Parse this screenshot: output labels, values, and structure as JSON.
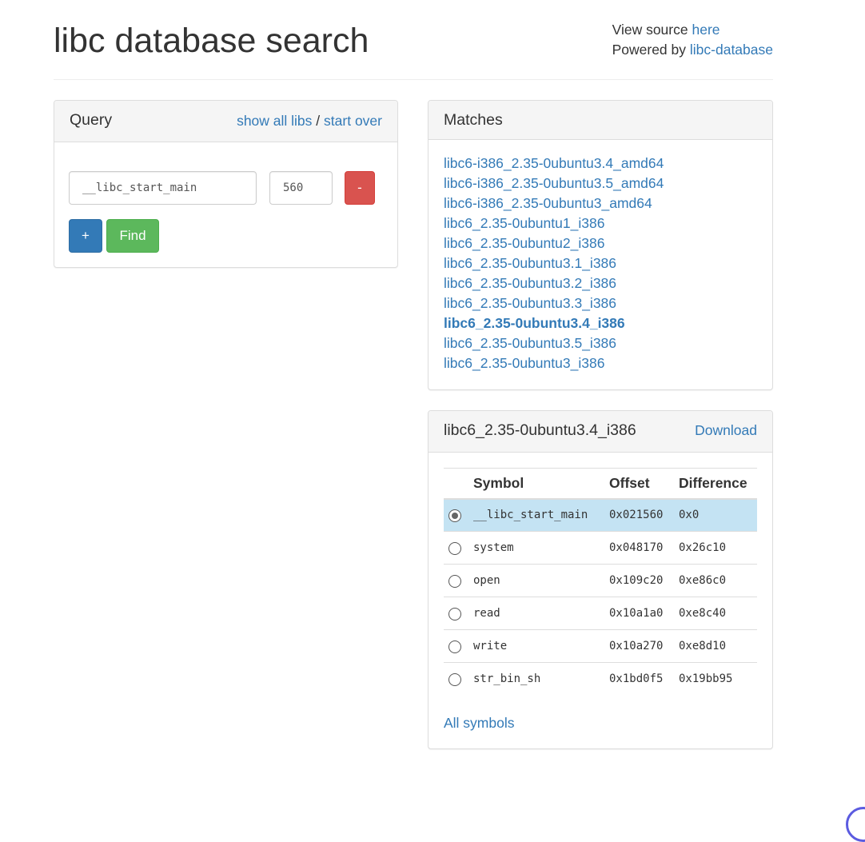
{
  "header": {
    "title": "libc database search",
    "view_source_prefix": "View source",
    "view_source_link": "here",
    "powered_by_prefix": "Powered by",
    "powered_by_link": "libc-database"
  },
  "query": {
    "title": "Query",
    "show_all_libs": "show all libs",
    "separator": "/",
    "start_over": "start over",
    "symbol_value": "__libc_start_main",
    "address_value": "560",
    "remove_label": "-",
    "add_label": "+",
    "find_label": "Find"
  },
  "matches": {
    "title": "Matches",
    "items": [
      "libc6-i386_2.35-0ubuntu3.4_amd64",
      "libc6-i386_2.35-0ubuntu3.5_amd64",
      "libc6-i386_2.35-0ubuntu3_amd64",
      "libc6_2.35-0ubuntu1_i386",
      "libc6_2.35-0ubuntu2_i386",
      "libc6_2.35-0ubuntu3.1_i386",
      "libc6_2.35-0ubuntu3.2_i386",
      "libc6_2.35-0ubuntu3.3_i386",
      "libc6_2.35-0ubuntu3.4_i386",
      "libc6_2.35-0ubuntu3.5_i386",
      "libc6_2.35-0ubuntu3_i386"
    ],
    "active_index": 8
  },
  "result": {
    "title": "libc6_2.35-0ubuntu3.4_i386",
    "download": "Download",
    "columns": [
      "Symbol",
      "Offset",
      "Difference"
    ],
    "rows": [
      {
        "symbol": "__libc_start_main",
        "offset": "0x021560",
        "difference": "0x0",
        "selected": true
      },
      {
        "symbol": "system",
        "offset": "0x048170",
        "difference": "0x26c10",
        "selected": false
      },
      {
        "symbol": "open",
        "offset": "0x109c20",
        "difference": "0xe86c0",
        "selected": false
      },
      {
        "symbol": "read",
        "offset": "0x10a1a0",
        "difference": "0xe8c40",
        "selected": false
      },
      {
        "symbol": "write",
        "offset": "0x10a270",
        "difference": "0xe8d10",
        "selected": false
      },
      {
        "symbol": "str_bin_sh",
        "offset": "0x1bd0f5",
        "difference": "0x19bb95",
        "selected": false
      }
    ],
    "all_symbols": "All symbols"
  }
}
